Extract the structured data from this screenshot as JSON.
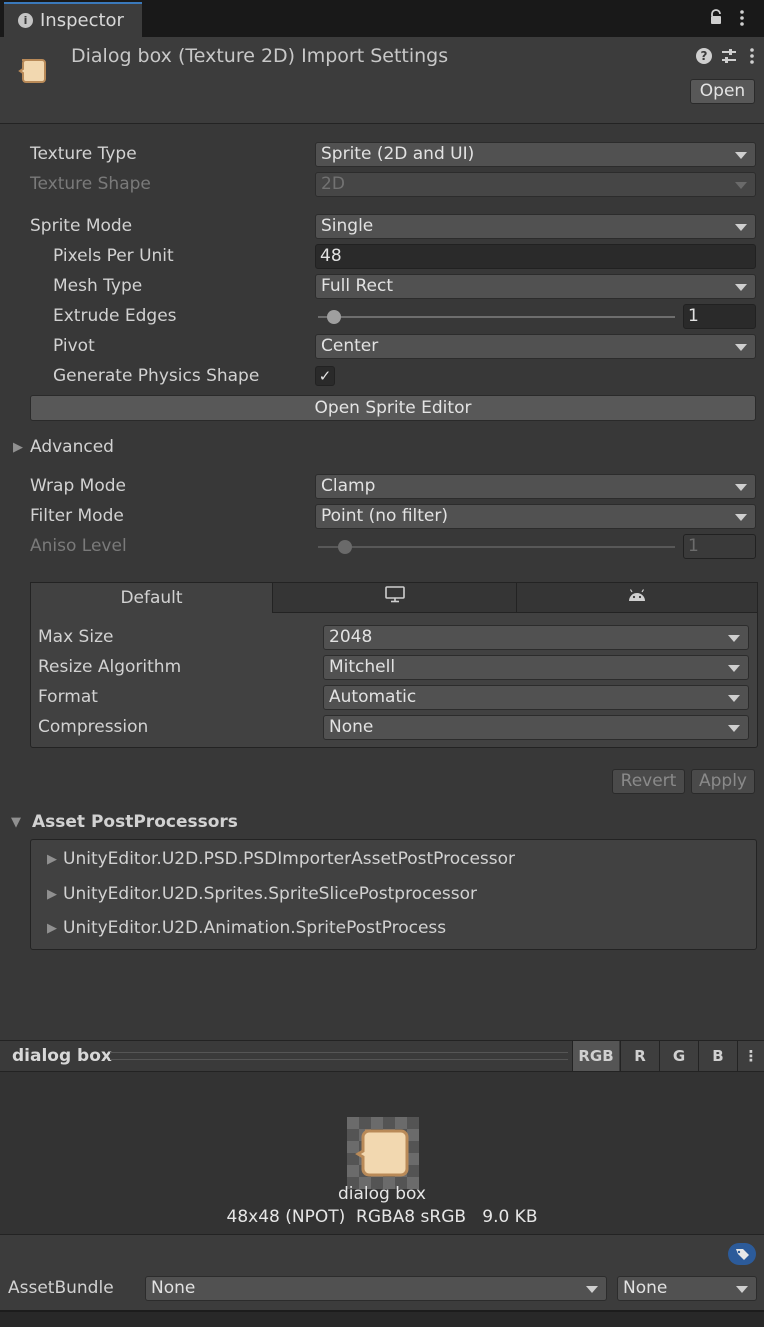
{
  "tab": {
    "title": "Inspector"
  },
  "header": {
    "title": "Dialog box (Texture 2D) Import Settings",
    "open_label": "Open"
  },
  "texture_type": {
    "label": "Texture Type",
    "value": "Sprite (2D and UI)"
  },
  "texture_shape": {
    "label": "Texture Shape",
    "value": "2D"
  },
  "sprite_mode": {
    "label": "Sprite Mode",
    "value": "Single"
  },
  "pixels_per_unit": {
    "label": "Pixels Per Unit",
    "value": "48"
  },
  "mesh_type": {
    "label": "Mesh Type",
    "value": "Full Rect"
  },
  "extrude_edges": {
    "label": "Extrude Edges",
    "value": "1",
    "slider_fraction": 0.03
  },
  "pivot": {
    "label": "Pivot",
    "value": "Center"
  },
  "physics_shape": {
    "label": "Generate Physics Shape",
    "checked": true,
    "check_glyph": "✓"
  },
  "sprite_editor": {
    "label": "Open Sprite Editor"
  },
  "advanced": {
    "label": "Advanced",
    "expanded": false
  },
  "wrap_mode": {
    "label": "Wrap Mode",
    "value": "Clamp"
  },
  "filter_mode": {
    "label": "Filter Mode",
    "value": "Point (no filter)"
  },
  "aniso_level": {
    "label": "Aniso Level",
    "value": "1",
    "slider_fraction": 0.06
  },
  "platform": {
    "tabs": [
      {
        "label": "Default",
        "icon": ""
      },
      {
        "label": "",
        "icon": "monitor-icon"
      },
      {
        "label": "",
        "icon": "android-icon"
      }
    ],
    "max_size": {
      "label": "Max Size",
      "value": "2048"
    },
    "resize_algorithm": {
      "label": "Resize Algorithm",
      "value": "Mitchell"
    },
    "format": {
      "label": "Format",
      "value": "Automatic"
    },
    "compression": {
      "label": "Compression",
      "value": "None"
    }
  },
  "actions": {
    "revert": "Revert",
    "apply": "Apply"
  },
  "postprocessors": {
    "title": "Asset PostProcessors",
    "items": [
      "UnityEditor.U2D.PSD.PSDImporterAssetPostProcessor",
      "UnityEditor.U2D.Sprites.SpriteSlicePostprocessor",
      "UnityEditor.U2D.Animation.SpritePostProcess"
    ]
  },
  "preview": {
    "title": "dialog box",
    "channels": [
      "RGB",
      "R",
      "G",
      "B"
    ],
    "name": "dialog box",
    "info": "48x48 (NPOT)  RGBA8 sRGB   9.0 KB"
  },
  "asset_bundle": {
    "label": "AssetBundle",
    "name": "None",
    "variant": "None"
  },
  "colors": {
    "accent": "#3a79bb",
    "panel": "#383838",
    "sprite_fill": "#f2d8b0",
    "sprite_stroke": "#b98a58"
  }
}
